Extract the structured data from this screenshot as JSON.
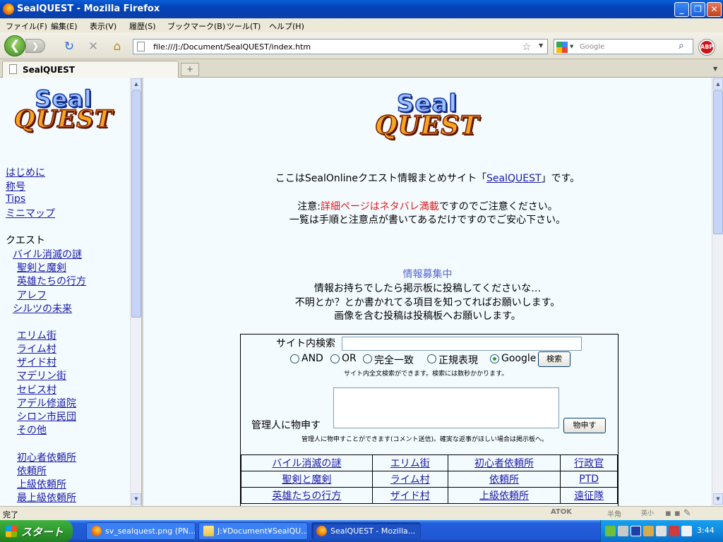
{
  "window": {
    "title": "SealQUEST - Mozilla Firefox"
  },
  "menu": [
    "ファイル(F)",
    "編集(E)",
    "表示(V)",
    "履歴(S)",
    "ブックマーク(B)",
    "ツール(T)",
    "ヘルプ(H)"
  ],
  "nav": {
    "url": "file:///J:/Document/SealQUEST/index.htm",
    "search_placeholder": "Google",
    "abp_label": "ABP"
  },
  "tab": {
    "label": "SealQUEST",
    "new_tab": "+"
  },
  "logo": {
    "seal": "Seal",
    "quest": "QUEST"
  },
  "sidebar": {
    "top_links": [
      "はじめに",
      "称号",
      "Tips",
      "ミニマップ"
    ],
    "quest_heading": "クエスト",
    "quest_group1": [
      "バイル消滅の謎",
      "聖剣と魔剣",
      "英雄たちの行方",
      "アレフ",
      "シルツの未来"
    ],
    "towns": [
      "エリム街",
      "ライム村",
      "ザイド村",
      "マデリン街",
      "セビス村",
      "アデル修道院",
      "シロン市民団",
      "その他"
    ],
    "requests": [
      "初心者依頼所",
      "依頼所",
      "上級依頼所",
      "最上級依頼所"
    ]
  },
  "main": {
    "intro_before": "ここはSealOnlineクエスト情報まとめサイト「",
    "intro_link": "SealQUEST",
    "intro_after": "」です。",
    "notice_prefix": "注意:",
    "notice_red": "詳細ページはネタバレ満載",
    "notice_suffix": "ですのでご注意ください。",
    "notice_line2": "一覧は手順と注意点が書いてあるだけですのでご安心下さい。",
    "recruit_title": "情報募集中",
    "recruit_lines": [
      "情報お持ちでしたら掲示板に投稿してくださいな…",
      "不明とか？とか書かれてる項目を知ってればお願いします。",
      "画像を含む投稿は投稿板へお願いします。"
    ]
  },
  "search": {
    "label": "サイト内検索",
    "value": "",
    "options": [
      "AND",
      "OR",
      "完全一致",
      "正規表現",
      "Google"
    ],
    "selected": "Google",
    "button": "検索",
    "note": "サイト内全文検索ができます。検索には数秒かかります。",
    "opinion_label": "管理人に物申す",
    "opinion_button": "物申す",
    "opinion_note": "管理人に物申すことができます(コメント送信)。確実な返事がほしい場合は掲示板へ。"
  },
  "link_table": [
    [
      "バイル消滅の謎",
      "エリム街",
      "初心者依頼所",
      "行政官"
    ],
    [
      "聖剣と魔剣",
      "ライム村",
      "依頼所",
      "PTD"
    ],
    [
      "英雄たちの行方",
      "ザイド村",
      "上級依頼所",
      "遠征隊"
    ]
  ],
  "status": {
    "text": "完了",
    "ime": [
      "ATOK",
      "半角",
      "英小"
    ]
  },
  "taskbar": {
    "start": "スタート",
    "tasks": [
      "sv_sealquest.png (PN...",
      "J:¥Document¥SealQU...",
      "SealQUEST - Mozilla..."
    ],
    "clock": "3:44"
  }
}
